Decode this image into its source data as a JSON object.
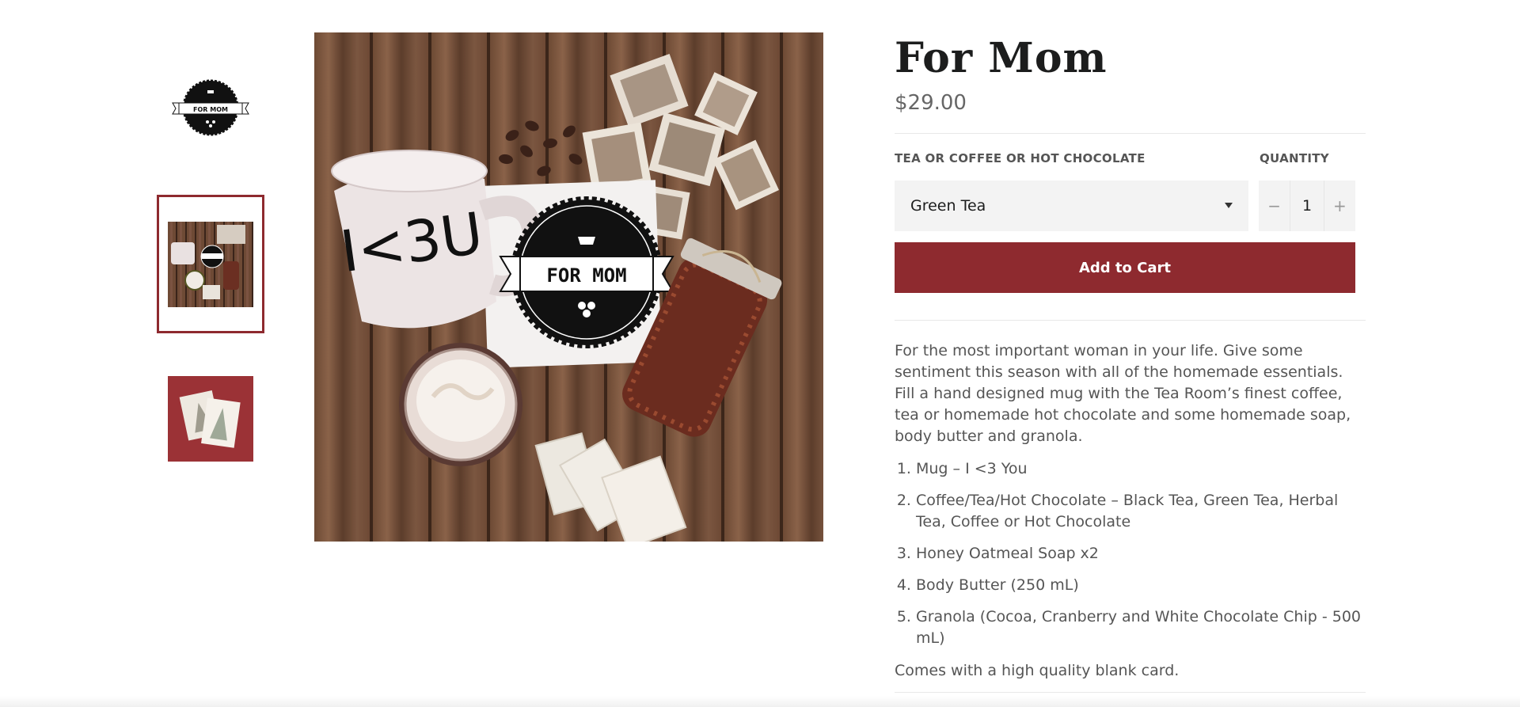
{
  "product": {
    "title": "For Mom",
    "price": "$29.00"
  },
  "options": {
    "variant_label": "TEA OR COFFEE OR HOT CHOCOLATE",
    "variant_selected": "Green Tea",
    "quantity_label": "QUANTITY",
    "quantity_value": "1",
    "minus_symbol": "−",
    "plus_symbol": "+"
  },
  "cart": {
    "add_label": "Add to Cart"
  },
  "description": {
    "intro": "For the most important woman in your life. Give some sentiment this season with all of the homemade essentials. Fill a hand designed mug with the Tea Room’s finest coffee, tea or homemade hot chocolate and some homemade soap, body butter and granola.",
    "items": [
      "Mug – I <3 You",
      "Coffee/Tea/Hot Chocolate – Black Tea, Green Tea, Herbal Tea, Coffee or Hot Chocolate",
      "Honey Oatmeal Soap x2",
      "Body Butter (250 mL)",
      "Granola (Cocoa, Cranberry and White Chocolate Chip - 500 mL)"
    ],
    "footer": "Comes with a high quality blank card."
  },
  "images": {
    "logo_text": "FOR MOM",
    "mug_text": "I<3U",
    "thumbnail_count": 3,
    "active_thumbnail_index": 1
  },
  "colors": {
    "accent": "#8e2a2f",
    "text": "#555555",
    "title": "#1c1d1d"
  }
}
